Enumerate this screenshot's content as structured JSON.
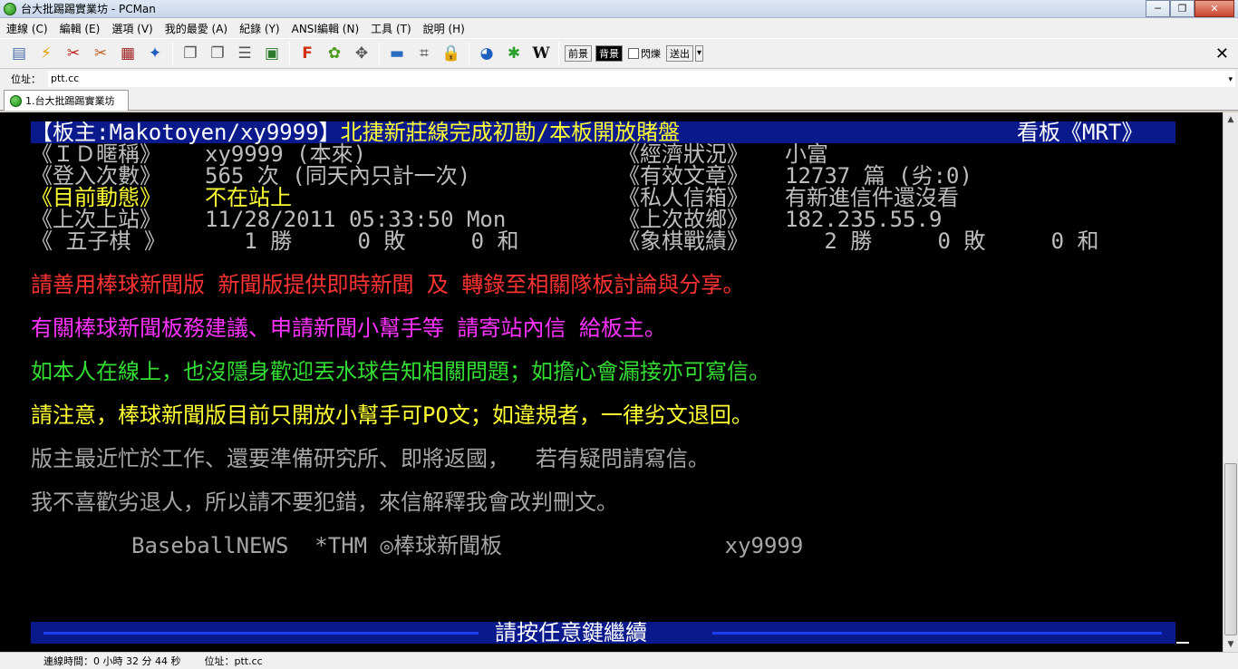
{
  "window": {
    "title": "台大批踢踢實業坊 - PCMan",
    "minimize": "─",
    "maximize": "❐",
    "close": "✕"
  },
  "menu": [
    "連線 (C)",
    "編輯 (E)",
    "選項 (V)",
    "我的最愛 (A)",
    "紀錄 (Y)",
    "ANSI編輯 (N)",
    "工具 (T)",
    "說明 (H)"
  ],
  "toolbar": {
    "fg_label": "前景",
    "bg_label": "背景",
    "blink_label": "閃爍",
    "send_label": "送出",
    "send_arrow": "▾",
    "close_glyph": "✕",
    "icon_glyphs": [
      "▤",
      "⚡",
      "✂",
      "✂",
      "▦",
      "✦",
      "❐",
      "❐",
      "☰",
      "▣",
      "F",
      "✿",
      "✥",
      "▬",
      "⌗",
      "🔒",
      "◕",
      "✱",
      "W"
    ]
  },
  "address": {
    "label": "位址：",
    "value": "ptt.cc",
    "arrow": "▾"
  },
  "tab": {
    "label": "1.台大批踢踢實業坊"
  },
  "terminal": {
    "header_left": "【板主:Makotoyen/xy9999】",
    "header_title": "北捷新莊線完成初勘/本板開放賭盤",
    "header_right": "看板《MRT》",
    "row1_label": "《ＩＤ暱稱》",
    "row1_value": "xy9999 (本來)",
    "row1_label2": "《經濟狀況》",
    "row1_value2": "小富",
    "row2_label": "《登入次數》",
    "row2_value": "565 次 (同天內只計一次)",
    "row2_label2": "《有效文章》",
    "row2_value2": "12737 篇 (劣:0)",
    "row3_label": "《目前動態》",
    "row3_value": "不在站上",
    "row3_label2": "《私人信箱》",
    "row3_value2": "有新進信件還沒看",
    "row4_label": "《上次上站》",
    "row4_value": "11/28/2011 05:33:50 Mon",
    "row4_label2": "《上次故鄉》",
    "row4_value2": "182.235.55.9",
    "row5_label": "《 五子棋 》",
    "row5_value": "   1 勝     0 敗     0 和",
    "row5_label2": "《象棋戰績》",
    "row5_value2": "   2 勝     0 敗     0 和",
    "msg_red": "請善用棒球新聞版 新聞版提供即時新聞 及 轉錄至相關隊板討論與分享。",
    "msg_magenta": "有關棒球新聞板務建議、申請新聞小幫手等 請寄站內信 給板主。",
    "msg_green": "如本人在線上，也沒隱身歡迎丟水球告知相關問題；如擔心會漏接亦可寫信。",
    "msg_yellow": "請注意，棒球新聞版目前只開放小幫手可PO文；如違規者，一律劣文退回。",
    "msg_gray1": "版主最近忙於工作、還要準備研究所、即將返國，  若有疑問請寫信。",
    "msg_gray2": "我不喜歡劣退人，所以請不要犯錯，來信解釋我會改判刪文。",
    "signature": "BaseballNEWS  *THM ◎棒球新聞板                 xy9999",
    "press_key": "請按任意鍵繼續"
  },
  "scrollbar": {
    "up": "▲",
    "down": "▼"
  },
  "status": {
    "conn_time": "連線時間：0 小時 32 分 44 秒",
    "address": "位址：ptt.cc"
  }
}
